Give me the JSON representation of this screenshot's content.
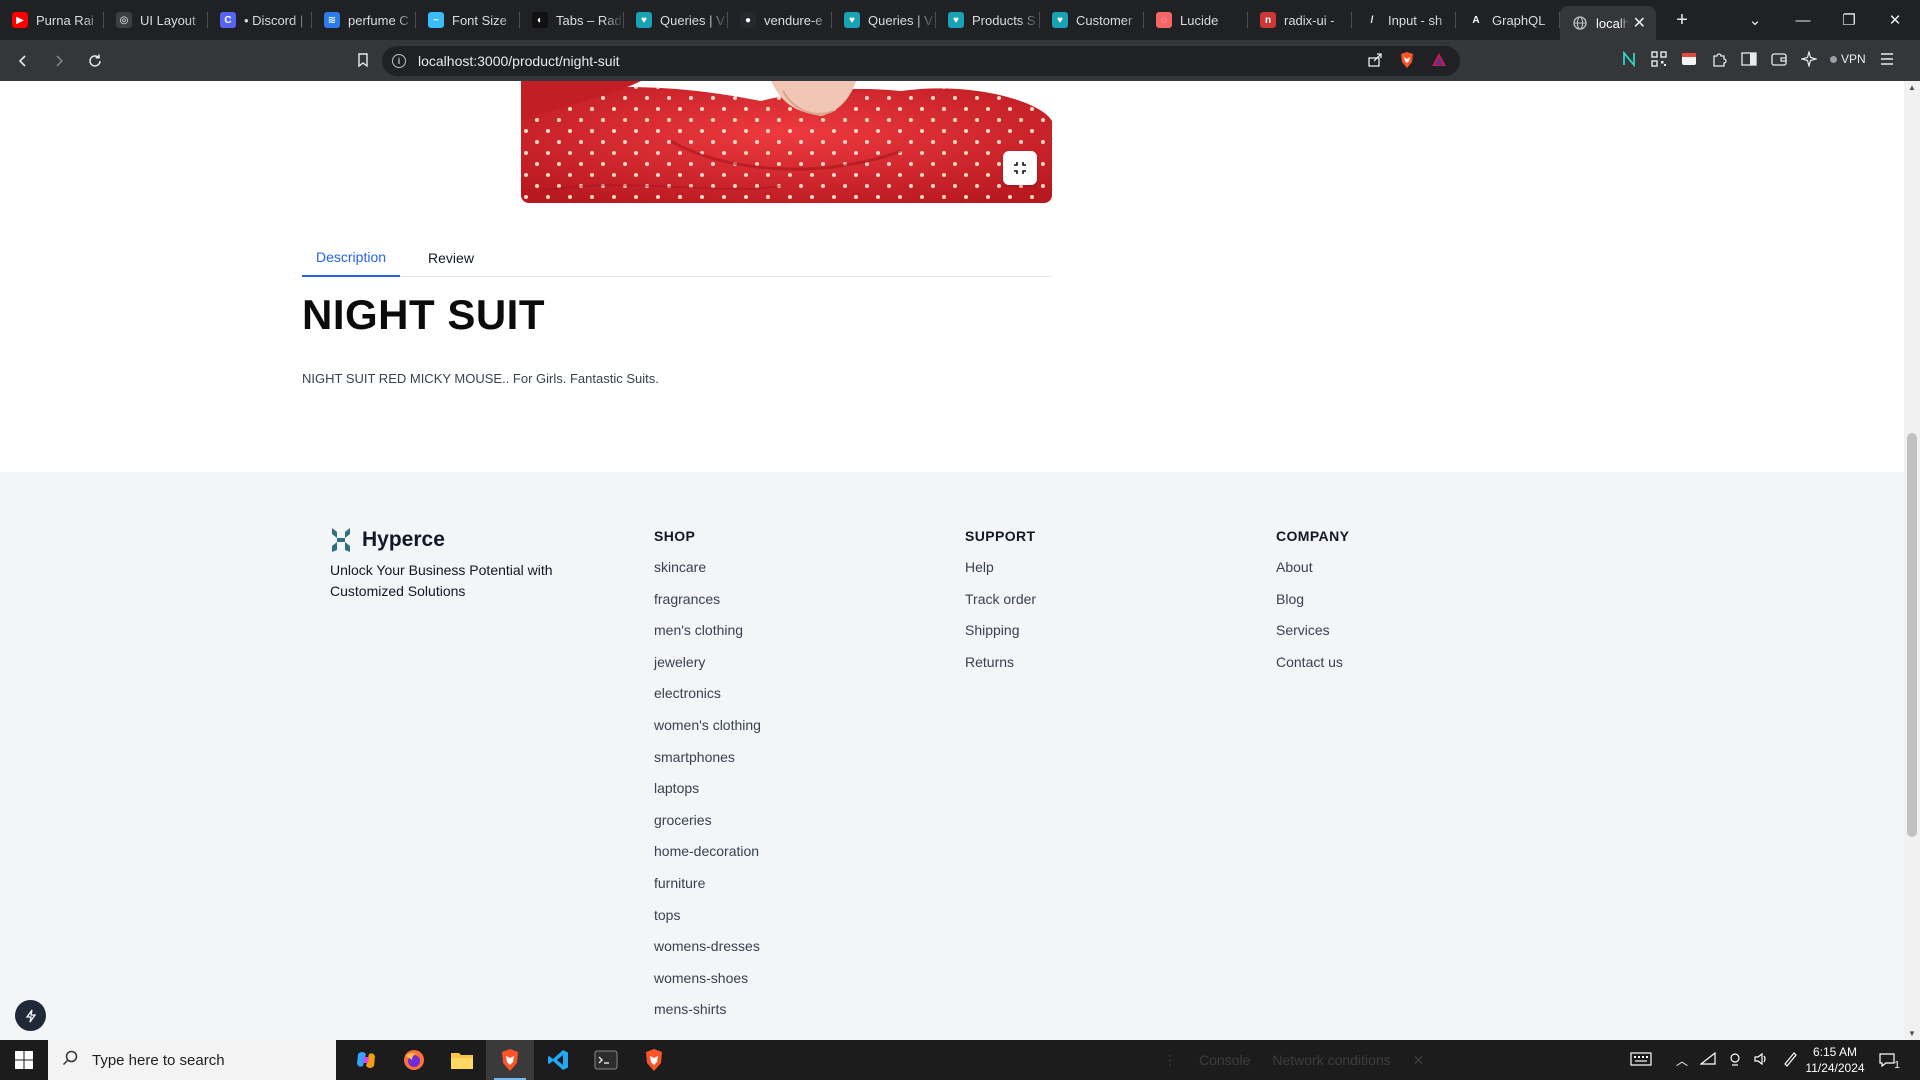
{
  "browser": {
    "tabs": [
      {
        "label": "Purna Rai",
        "color": "#ff0000",
        "glyph": "▶"
      },
      {
        "label": "UI Layout",
        "color": "#3c4043",
        "glyph": "◎"
      },
      {
        "label": "• Discord |",
        "color": "#5865f2",
        "glyph": "C"
      },
      {
        "label": "perfume C",
        "color": "#2b7de9",
        "glyph": "≋"
      },
      {
        "label": "Font Size",
        "color": "#38bdf8",
        "glyph": "~"
      },
      {
        "label": "Tabs – Rad",
        "color": "#111111",
        "glyph": "◐"
      },
      {
        "label": "Queries | V",
        "color": "#17a2b8",
        "glyph": "♥"
      },
      {
        "label": "vendure-e",
        "color": "#24292e",
        "glyph": "●"
      },
      {
        "label": "Queries | V",
        "color": "#17a2b8",
        "glyph": "♥"
      },
      {
        "label": "Products S",
        "color": "#17a2b8",
        "glyph": "♥"
      },
      {
        "label": "Customer",
        "color": "#17a2b8",
        "glyph": "♥"
      },
      {
        "label": "Lucide",
        "color": "#f56565",
        "glyph": "◌"
      },
      {
        "label": "radix-ui - ",
        "color": "#cb3837",
        "glyph": "n"
      },
      {
        "label": "Input - sh",
        "color": "#202124",
        "glyph": "/"
      },
      {
        "label": "GraphQL",
        "color": "#202124",
        "glyph": "A"
      }
    ],
    "active_tab": {
      "label": "localh"
    },
    "url": "localhost:3000/product/night-suit",
    "vpn_label": "VPN"
  },
  "product": {
    "tabs": [
      "Description",
      "Review"
    ],
    "title": "NIGHT SUIT",
    "description": "NIGHT SUIT RED MICKY MOUSE.. For Girls. Fantastic Suits."
  },
  "footer": {
    "brand": "Hyperce",
    "tagline": "Unlock Your Business Potential with Customized Solutions",
    "shop": {
      "heading": "SHOP",
      "links": [
        "skincare",
        "fragrances",
        "men's clothing",
        "jewelery",
        "electronics",
        "women's clothing",
        "smartphones",
        "laptops",
        "groceries",
        "home-decoration",
        "furniture",
        "tops",
        "womens-dresses",
        "womens-shoes",
        "mens-shirts"
      ]
    },
    "support": {
      "heading": "SUPPORT",
      "links": [
        "Help",
        "Track order",
        "Shipping",
        "Returns"
      ]
    },
    "company": {
      "heading": "COMPANY",
      "links": [
        "About",
        "Blog",
        "Services",
        "Contact us"
      ]
    }
  },
  "taskbar": {
    "search_placeholder": "Type here to search",
    "devtools": [
      "Console",
      "Network conditions"
    ],
    "time": "6:15 AM",
    "date": "11/24/2024",
    "notification_count": "1"
  },
  "colors": {
    "accent": "#2563eb",
    "product_red": "#d9252d",
    "footer_bg": "#f4f5f7",
    "brand_teal": "#2f6f7e"
  }
}
